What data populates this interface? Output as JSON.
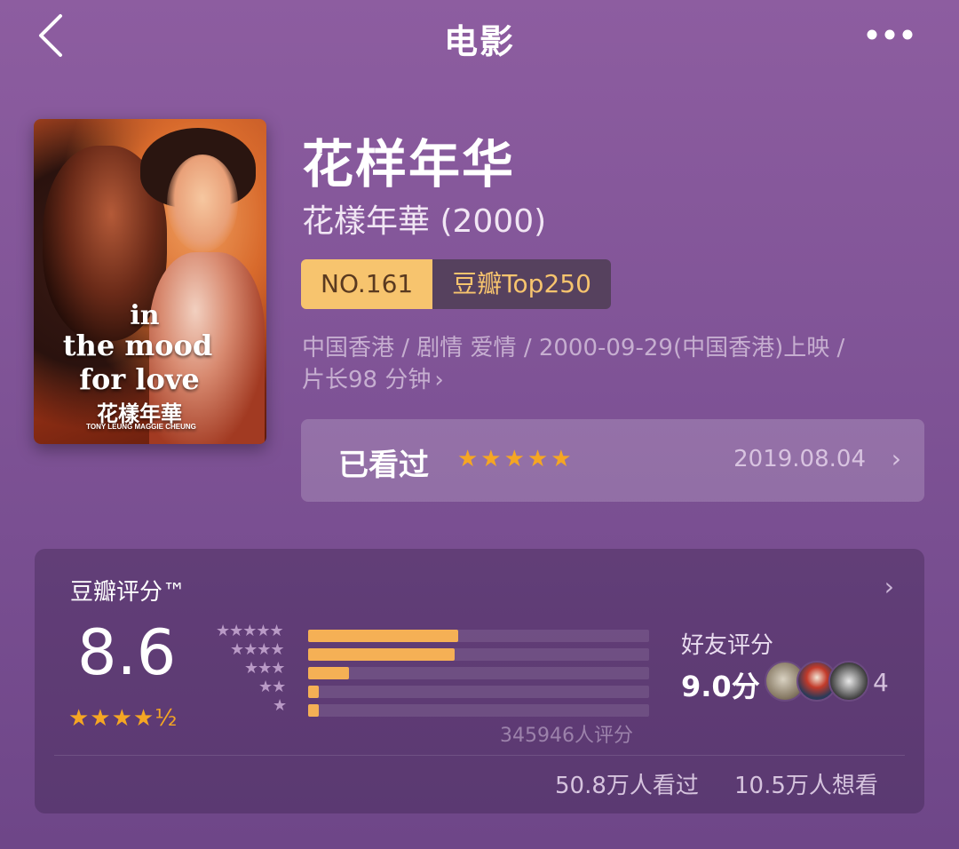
{
  "nav": {
    "back_icon": "chevron-left-icon",
    "title": "电影",
    "more_icon": "more-dots-icon"
  },
  "poster": {
    "line1": "in",
    "line2": "the mood",
    "line3": "for love",
    "line4": "花樣年華",
    "credits": "TONY LEUNG   MAGGIE CHEUNG"
  },
  "movie": {
    "title": "花样年华",
    "original_title": "花樣年華 (2000)",
    "rank_no": "NO.161",
    "rank_list": "豆瓣Top250",
    "meta_line1": "中国香港 / 剧情 爱情 / 2000-09-29(中国香港)上映 /",
    "meta_line2": "片长98 分钟",
    "meta_chevron": "›"
  },
  "watched": {
    "label": "已看过",
    "stars": "★★★★★",
    "user_rating": 5,
    "date": "2019.08.04",
    "chevron": "›"
  },
  "rating": {
    "title": "豆瓣评分™",
    "chevron": "›",
    "score": "8.6",
    "stars_display": "★★★★½",
    "histogram": [
      {
        "stars": "★★★★★",
        "fraction": 0.44
      },
      {
        "stars": "★★★★",
        "fraction": 0.43
      },
      {
        "stars": "★★★",
        "fraction": 0.12
      },
      {
        "stars": "★★",
        "fraction": 0.03
      },
      {
        "stars": "★",
        "fraction": 0.03
      }
    ],
    "votes": "345946人评分",
    "friends_label": "好友评分",
    "friends_score": "9.0分",
    "friends_count": "4",
    "watched_count": "50.8万人看过",
    "want_count": "10.5万人想看"
  },
  "colors": {
    "background": "#8d5da0",
    "accent_star": "#f5a623",
    "rank_badge": "#f7c46e",
    "histogram_bar": "#f5b055"
  }
}
